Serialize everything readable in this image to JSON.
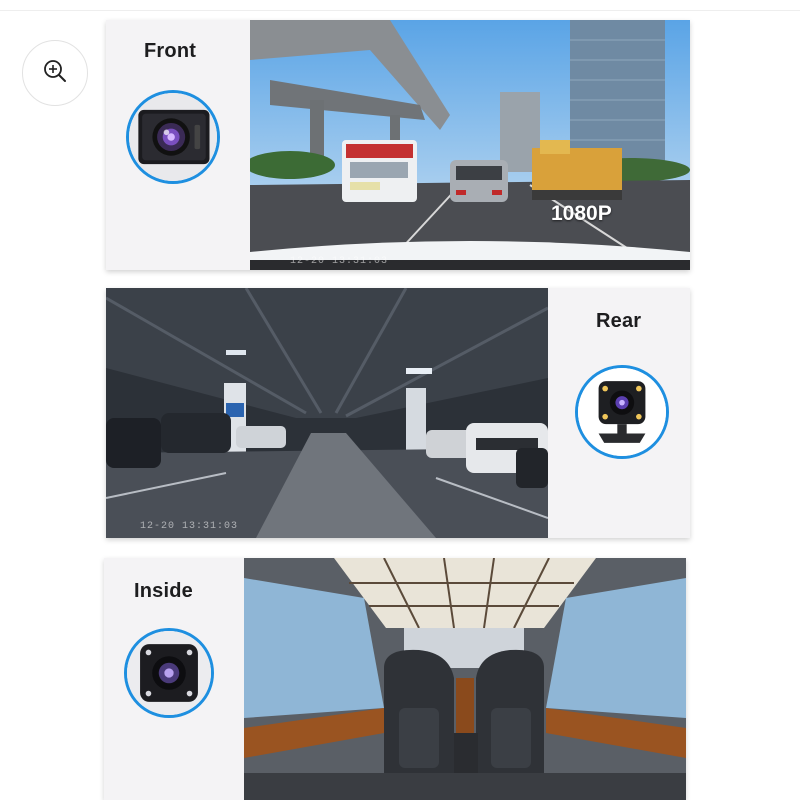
{
  "zoom_button": {
    "icon": "zoom-in-icon"
  },
  "cards": {
    "front": {
      "label": "Front",
      "resolution_badge": "1080P",
      "timestamp": "12-20 13:31:03",
      "camera_icon": "front-camera-icon"
    },
    "rear": {
      "label": "Rear",
      "timestamp": "12-20 13:31:03",
      "camera_icon": "rear-camera-icon"
    },
    "inside": {
      "label": "Inside",
      "camera_icon": "inside-camera-icon"
    }
  },
  "colors": {
    "accent_ring": "#1e8fe0",
    "card_bg": "#f4f3f5",
    "label_text": "#1d1d1f"
  }
}
